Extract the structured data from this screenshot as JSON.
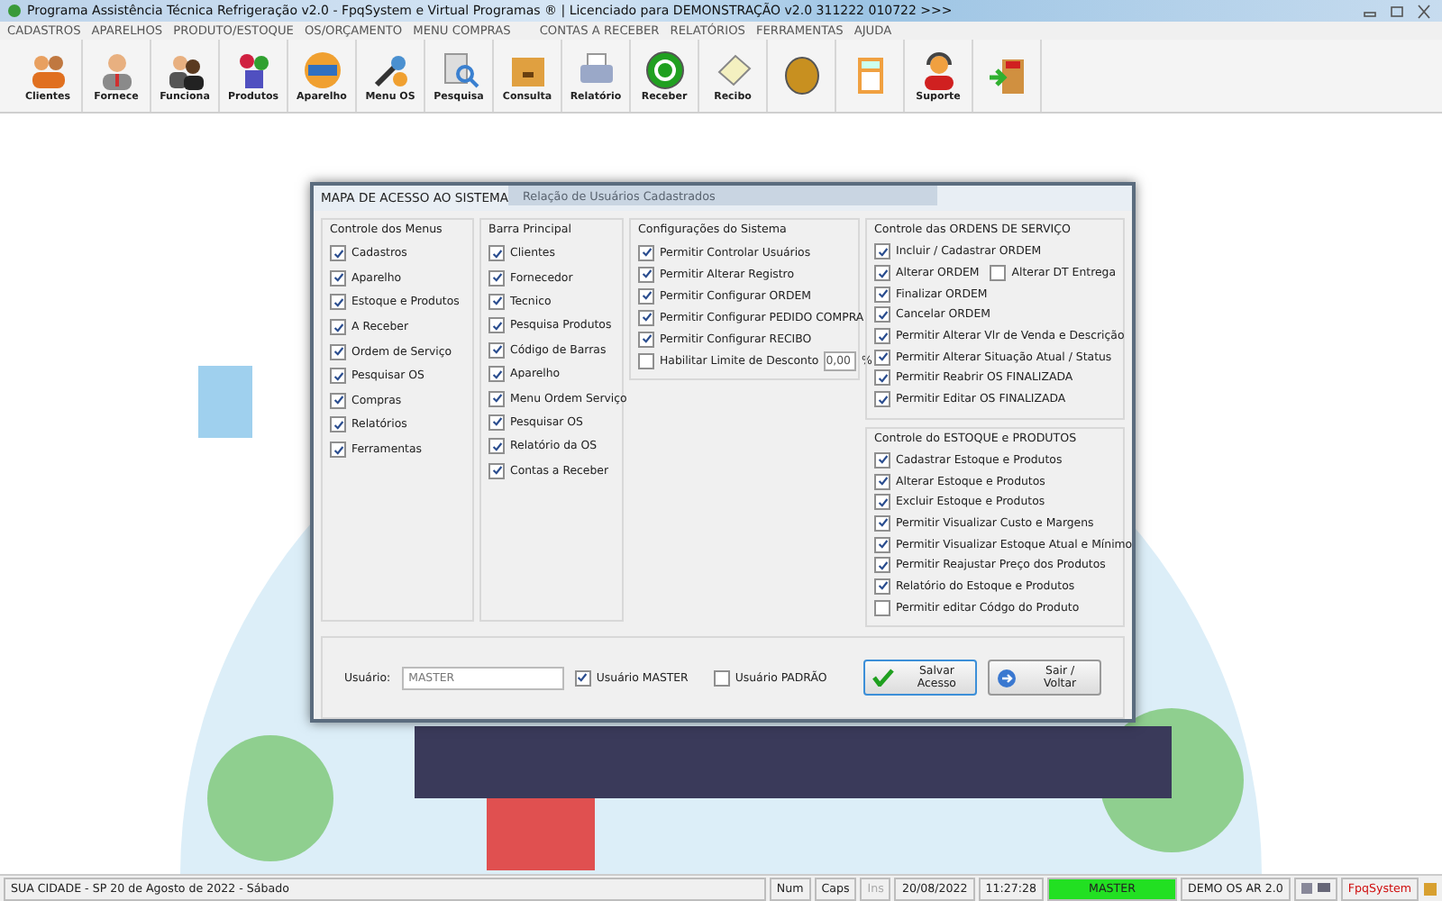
{
  "window": {
    "title": "Programa Assistência Técnica Refrigeração v2.0 - FpqSystem e Virtual Programas ® | Licenciado para  DEMONSTRAÇÃO v2.0 311222 010722 >>>"
  },
  "menu": [
    "CADASTROS",
    "APARELHOS",
    "PRODUTO/ESTOQUE",
    "OS/ORÇAMENTO",
    "MENU COMPRAS",
    "CONTAS A RECEBER",
    "RELATÓRIOS",
    "FERRAMENTAS",
    "AJUDA"
  ],
  "toolbar": [
    {
      "kind": "clients",
      "label": "Clientes"
    },
    {
      "kind": "person",
      "label": "Fornece"
    },
    {
      "kind": "people",
      "label": "Funciona"
    },
    {
      "kind": "products",
      "label": "Produtos"
    },
    {
      "kind": "device",
      "label": "Aparelho"
    },
    {
      "kind": "tools",
      "label": "Menu OS"
    },
    {
      "kind": "search",
      "label": "Pesquisa"
    },
    {
      "kind": "drawer",
      "label": "Consulta"
    },
    {
      "kind": "printer",
      "label": "Relatório"
    },
    {
      "kind": "money",
      "label": "Receber"
    },
    {
      "kind": "receipt",
      "label": "Recibo"
    },
    {
      "kind": "coin"
    },
    {
      "kind": "calculator"
    },
    {
      "kind": "support",
      "label": "Suporte"
    },
    {
      "kind": "exit"
    }
  ],
  "background_window": {
    "title": "Relação de Usuários Cadastrados"
  },
  "dialog": {
    "title": "MAPA DE ACESSO AO SISTEMA",
    "menus": {
      "title": "Controle dos Menus",
      "items": [
        {
          "label": "Cadastros",
          "checked": true
        },
        {
          "label": "Aparelho",
          "checked": true
        },
        {
          "label": "Estoque e Produtos",
          "checked": true
        },
        {
          "label": "A Receber",
          "checked": true
        },
        {
          "label": "Ordem de Serviço",
          "checked": true
        },
        {
          "label": "Pesquisar OS",
          "checked": true
        },
        {
          "label": "Compras",
          "checked": true
        },
        {
          "label": "Relatórios",
          "checked": true
        },
        {
          "label": "Ferramentas",
          "checked": true
        }
      ]
    },
    "main_bar": {
      "title": "Barra Principal",
      "items": [
        {
          "label": "Clientes",
          "checked": true
        },
        {
          "label": "Fornecedor",
          "checked": true
        },
        {
          "label": "Tecnico",
          "checked": true
        },
        {
          "label": "Pesquisa Produtos",
          "checked": true
        },
        {
          "label": "Código de Barras",
          "checked": true
        },
        {
          "label": "Aparelho",
          "checked": true
        },
        {
          "label": "Menu Ordem Serviço",
          "checked": true
        },
        {
          "label": "Pesquisar OS",
          "checked": true
        },
        {
          "label": "Relatório da OS",
          "checked": true
        },
        {
          "label": "Contas a Receber",
          "checked": true
        }
      ]
    },
    "settings": {
      "title": "Configurações do Sistema",
      "items": [
        {
          "label": "Permitir Controlar Usuários",
          "checked": true
        },
        {
          "label": "Permitir Alterar Registro",
          "checked": true
        },
        {
          "label": "Permitir Configurar ORDEM",
          "checked": true
        },
        {
          "label": "Permitir Configurar PEDIDO COMPRA",
          "checked": true
        },
        {
          "label": "Permitir Configurar RECIBO",
          "checked": true
        },
        {
          "label": "Habilitar Limite de Desconto",
          "checked": false,
          "value": "0,00",
          "unit": "%"
        }
      ]
    },
    "orders": {
      "title": "Controle das ORDENS DE SERVIÇO",
      "items": [
        {
          "label": "Incluir / Cadastrar ORDEM",
          "checked": true
        },
        {
          "label": "Alterar ORDEM",
          "checked": true,
          "extra": {
            "label": "Alterar DT Entrega",
            "checked": false
          }
        },
        {
          "label": "Finalizar ORDEM",
          "checked": true
        },
        {
          "label": "Cancelar ORDEM",
          "checked": true
        },
        {
          "label": "Permitir Alterar Vlr de Venda e Descrição",
          "checked": true
        },
        {
          "label": "Permitir Alterar Situação Atual / Status",
          "checked": true
        },
        {
          "label": "Permitir Reabrir OS FINALIZADA",
          "checked": true
        },
        {
          "label": "Permitir Editar OS FINALIZADA",
          "checked": true
        }
      ]
    },
    "stock": {
      "title": "Controle do ESTOQUE e PRODUTOS",
      "items": [
        {
          "label": "Cadastrar Estoque e Produtos",
          "checked": true
        },
        {
          "label": "Alterar Estoque e Produtos",
          "checked": true
        },
        {
          "label": "Excluir Estoque e Produtos",
          "checked": true
        },
        {
          "label": "Permitir Visualizar Custo e Margens",
          "checked": true
        },
        {
          "label": "Permitir Visualizar Estoque Atual e Mínimo",
          "checked": true
        },
        {
          "label": "Permitir Reajustar Preço dos Produtos",
          "checked": true
        },
        {
          "label": "Relatório do Estoque e Produtos",
          "checked": true
        },
        {
          "label": "Permitir editar Códgo do Produto",
          "checked": false
        }
      ]
    },
    "user": {
      "label": "Usuário:",
      "value": "MASTER"
    },
    "roles": [
      {
        "label": "Usuário MASTER",
        "checked": true
      },
      {
        "label": "Usuário PADRÃO",
        "checked": false
      }
    ],
    "buttons": [
      {
        "kind": "save",
        "label": "Salvar Acesso"
      },
      {
        "kind": "exit",
        "label": "Sair / Voltar"
      }
    ]
  },
  "status_bar": [
    {
      "kind": "wide",
      "text": "SUA CIDADE - SP 20 de Agosto de 2022 - Sábado",
      "disabled": false
    },
    {
      "kind": "plain",
      "text": "Num",
      "disabled": false
    },
    {
      "kind": "plain",
      "text": "Caps",
      "disabled": false
    },
    {
      "kind": "plain",
      "text": "Ins",
      "disabled": true
    },
    {
      "kind": "plain",
      "text": "20/08/2022",
      "disabled": false
    },
    {
      "kind": "plain",
      "text": "11:27:28",
      "disabled": false
    },
    {
      "kind": "user",
      "text": "MASTER",
      "disabled": false
    },
    {
      "kind": "version",
      "text": "DEMO OS AR 2.0",
      "disabled": false
    },
    {
      "kind": "iconpair"
    },
    {
      "kind": "brand",
      "text": "FpqSystem",
      "disabled": false
    },
    {
      "kind": "icon"
    }
  ]
}
